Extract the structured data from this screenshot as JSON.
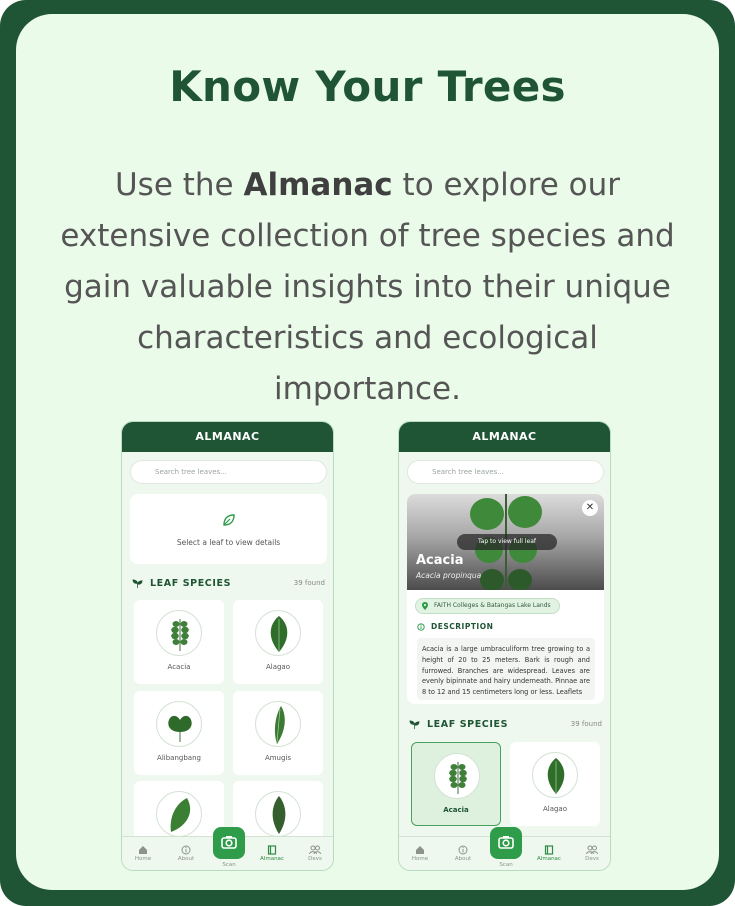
{
  "headline": "Know Your Trees",
  "intro": {
    "before": "Use the ",
    "brand": "Almanac",
    "after": " to explore our extensive collection of tree species and gain valuable insights into their unique characteristics and ecological importance."
  },
  "colors": {
    "dark_green": "#1f5434",
    "accent_green": "#2f9c4a",
    "panel_bg": "#eafbea"
  },
  "phone_left": {
    "title": "ALMANAC",
    "search_placeholder": "Search tree leaves...",
    "empty_state": "Select a leaf to view details",
    "section_title": "LEAF SPECIES",
    "count": "39 found",
    "species": [
      "Acacia",
      "Alagao",
      "Alibangbang",
      "Amugis",
      "",
      ""
    ]
  },
  "phone_right": {
    "title": "ALMANAC",
    "search_placeholder": "Search tree leaves...",
    "tap_hint": "Tap to view full leaf",
    "close_icon": "close-icon",
    "species_name": "Acacia",
    "scientific_name": "Acacia propinqua",
    "location": "FAITH Colleges & Batangas Lake Lands",
    "description_title": "DESCRIPTION",
    "description": "Acacia is a large umbraculiform tree growing to a height of 20 to 25 meters. Bark is rough and furrowed. Branches are widespread. Leaves are evenly bipinnate and hairy underneath. Pinnae are 8 to 12 and 15 centimeters long or less. Leaflets",
    "section_title": "LEAF SPECIES",
    "count": "39 found",
    "species": [
      "Acacia",
      "Alagao"
    ]
  },
  "nav": {
    "home": "Home",
    "about": "About",
    "scan": "Scan",
    "almanac": "Almanac",
    "devs": "Devs"
  }
}
